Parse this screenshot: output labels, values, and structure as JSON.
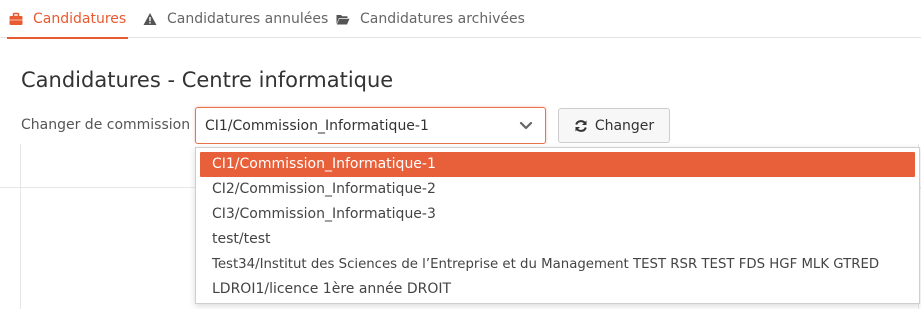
{
  "tabs": [
    {
      "label": "Candidatures",
      "icon": "briefcase-icon",
      "active": true
    },
    {
      "label": "Candidatures annulées",
      "icon": "warning-icon",
      "active": false
    },
    {
      "label": "Candidatures archivées",
      "icon": "folder-open-icon",
      "active": false
    }
  ],
  "page": {
    "title": "Candidatures - Centre informatique"
  },
  "commission": {
    "label": "Changer de commission",
    "selected": "CI1/Commission_Informatique-1",
    "button_label": "Changer",
    "options": [
      "CI1/Commission_Informatique-1",
      "CI2/Commission_Informatique-2",
      "CI3/Commission_Informatique-3",
      "test/test",
      "Test34/Institut des Sciences de l’Entreprise et du Management TEST RSR TEST FDS HGF MLK GTRED",
      "LDROI1/licence 1ère année DROIT"
    ]
  },
  "colors": {
    "accent": "#e85a30",
    "selected_option_bg": "#e8603a"
  }
}
